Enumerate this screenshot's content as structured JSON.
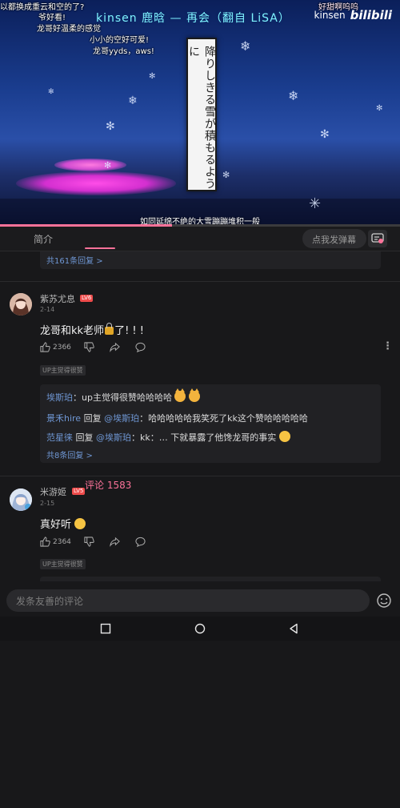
{
  "video": {
    "title_overlay": "kinsen 鹿晗 — 再会（翻自 LiSA）",
    "watermark_name": "kinsen",
    "watermark_logo": "bilibili",
    "banner_text": "降りしきる雪が積もるように",
    "subtitle": "如同延绵不绝的大雪蹦蹦堆积一般",
    "danmaku": [
      "以都换成重云和空的了?",
      "爷好看!",
      "龙哥好温柔的感觉",
      "小小的空好可爱!",
      "龙哥yyds，aws!",
      "好甜啊呜呜"
    ],
    "progress": 0.43
  },
  "tabs": {
    "intro": "简介",
    "comments": "评论 1583",
    "danmaku_placeholder": "点我发弹幕",
    "danmaku_toggle_icon": "danmaku-icon"
  },
  "prev_thread": {
    "more_replies": "共161条回复 >"
  },
  "comments": [
    {
      "user": "紫苏尤息",
      "level": "LV6",
      "date": "2-14",
      "text_before": "龙哥和kk老师",
      "text_after": "了! ! !",
      "likes": "2366",
      "up_tag": "UP主觉得很赞",
      "replies": [
        {
          "name": "埃斯珀",
          "text": "：up主觉得很赞哈哈哈哈"
        },
        {
          "name": "景禾hire",
          "prefix": " 回复 ",
          "target": "@埃斯珀",
          "text": "：哈哈哈哈哈我笑死了kk这个赞哈哈哈哈哈"
        },
        {
          "name": "范星徕",
          "prefix": " 回复 ",
          "target": "@埃斯珀",
          "text": "：kk：… 下就暴露了他馋龙哥的事实"
        }
      ],
      "reply_count": "共8条回复 >"
    },
    {
      "user": "米游姬",
      "level": "LV5",
      "date": "2-15",
      "text": "真好听",
      "likes": "2364",
      "up_tag": "UP主觉得很赞"
    }
  ],
  "comment_bar": {
    "placeholder": "发条友善的评论"
  },
  "navbar": {
    "back_icon": "back-icon",
    "home_icon": "home-icon",
    "recents_icon": "recents-icon"
  },
  "colors": {
    "accent": "#fb7299",
    "link": "#6f97d4",
    "title_overlay": "#7ff3ff"
  }
}
